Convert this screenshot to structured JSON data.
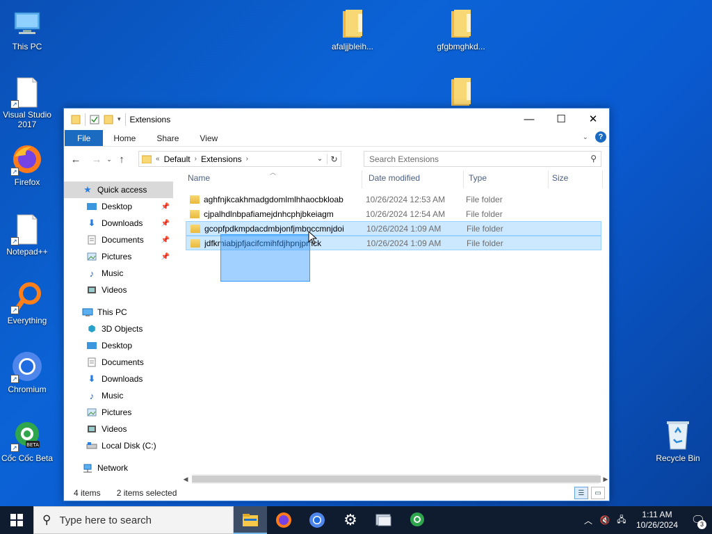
{
  "desktop": {
    "icons": [
      {
        "label": "This PC",
        "icon": "this-pc-icon"
      },
      {
        "label": "Visual Studio 2017",
        "icon": "visual-studio-icon"
      },
      {
        "label": "Firefox",
        "icon": "firefox-icon"
      },
      {
        "label": "Notepad++",
        "icon": "notepadpp-icon"
      },
      {
        "label": "Everything",
        "icon": "everything-icon"
      },
      {
        "label": "Chromium",
        "icon": "chromium-icon"
      },
      {
        "label": "Cốc Cốc Beta",
        "icon": "coccoc-icon"
      },
      {
        "label": "afaljjbleih...",
        "icon": "folder-icon"
      },
      {
        "label": "gfgbmghkd...",
        "icon": "folder-icon"
      },
      {
        "label": "",
        "icon": "folder-icon"
      },
      {
        "label": "Recycle Bin",
        "icon": "recycle-bin-icon"
      }
    ]
  },
  "window": {
    "title": "Extensions",
    "controls": {
      "minimize": "—",
      "maximize": "☐",
      "close": "✕"
    },
    "ribbon_tabs": [
      "File",
      "Home",
      "Share",
      "View"
    ],
    "address": {
      "prefix": "«",
      "crumbs": [
        "Default",
        "Extensions"
      ]
    },
    "search_placeholder": "Search Extensions",
    "sidebar": {
      "quick_access": "Quick access",
      "quick_items": [
        "Desktop",
        "Downloads",
        "Documents",
        "Pictures",
        "Music",
        "Videos"
      ],
      "this_pc": "This PC",
      "pc_items": [
        "3D Objects",
        "Desktop",
        "Documents",
        "Downloads",
        "Music",
        "Pictures",
        "Videos",
        "Local Disk (C:)"
      ],
      "network": "Network"
    },
    "columns": {
      "name": "Name",
      "date": "Date modified",
      "type": "Type",
      "size": "Size"
    },
    "files": [
      {
        "name": "aghfnjkcakhmadgdomlmlhhaocbkloab",
        "date": "10/26/2024 12:53 AM",
        "type": "File folder",
        "selected": false
      },
      {
        "name": "cjpalhdlnbpafiamejdnhcphjbkeiagm",
        "date": "10/26/2024 12:54 AM",
        "type": "File folder",
        "selected": false
      },
      {
        "name": "gcopfpdkmpdacdmbjonfjmbnccmnjdoi",
        "date": "10/26/2024 1:09 AM",
        "type": "File folder",
        "selected": true
      },
      {
        "name": "jdfkmiabjpfjacifcmihfdjhpnjpmck",
        "date": "10/26/2024 1:09 AM",
        "type": "File folder",
        "selected": true
      }
    ],
    "status": {
      "items": "4 items",
      "selected": "2 items selected"
    }
  },
  "taskbar": {
    "search_placeholder": "Type here to search",
    "time": "1:11 AM",
    "date": "10/26/2024",
    "notification_count": "3"
  }
}
